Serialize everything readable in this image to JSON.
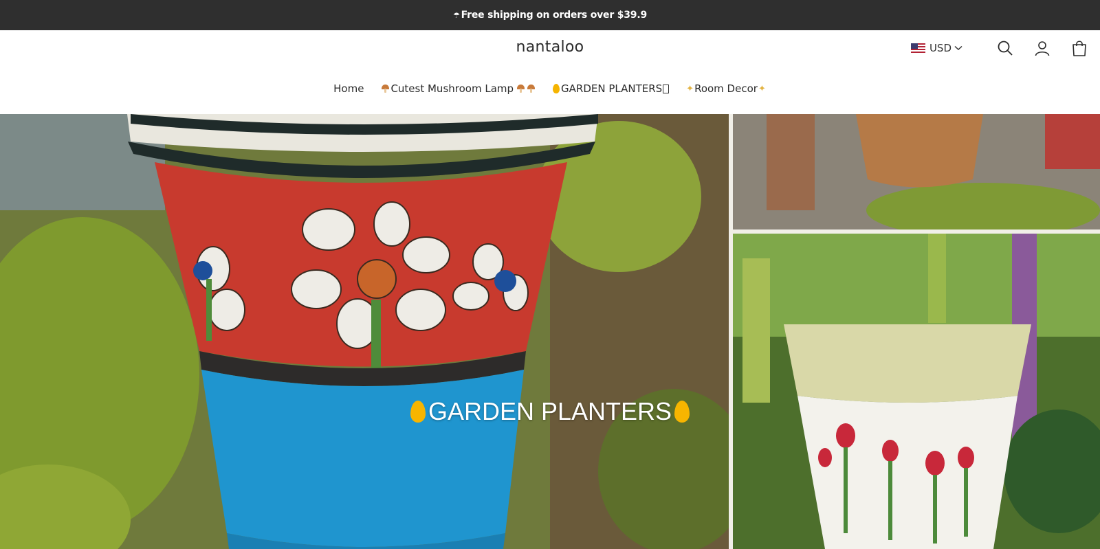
{
  "announcement": {
    "icon": "rainbow-icon",
    "text": "Free shipping on orders over $39.9"
  },
  "header": {
    "logo": "nantaloo",
    "currency": "USD",
    "icons": [
      "search-icon",
      "account-icon",
      "cart-icon"
    ]
  },
  "nav": {
    "items": [
      {
        "label": "Home"
      },
      {
        "label": "Cutest Mushroom Lamp"
      },
      {
        "label": "GARDEN PLANTERS"
      },
      {
        "label": "Room Decor"
      }
    ]
  },
  "hero": {
    "title": "GARDEN PLANTERS"
  },
  "colors": {
    "announcement_bg": "#2f2f2f",
    "flame": "#f5b400"
  }
}
